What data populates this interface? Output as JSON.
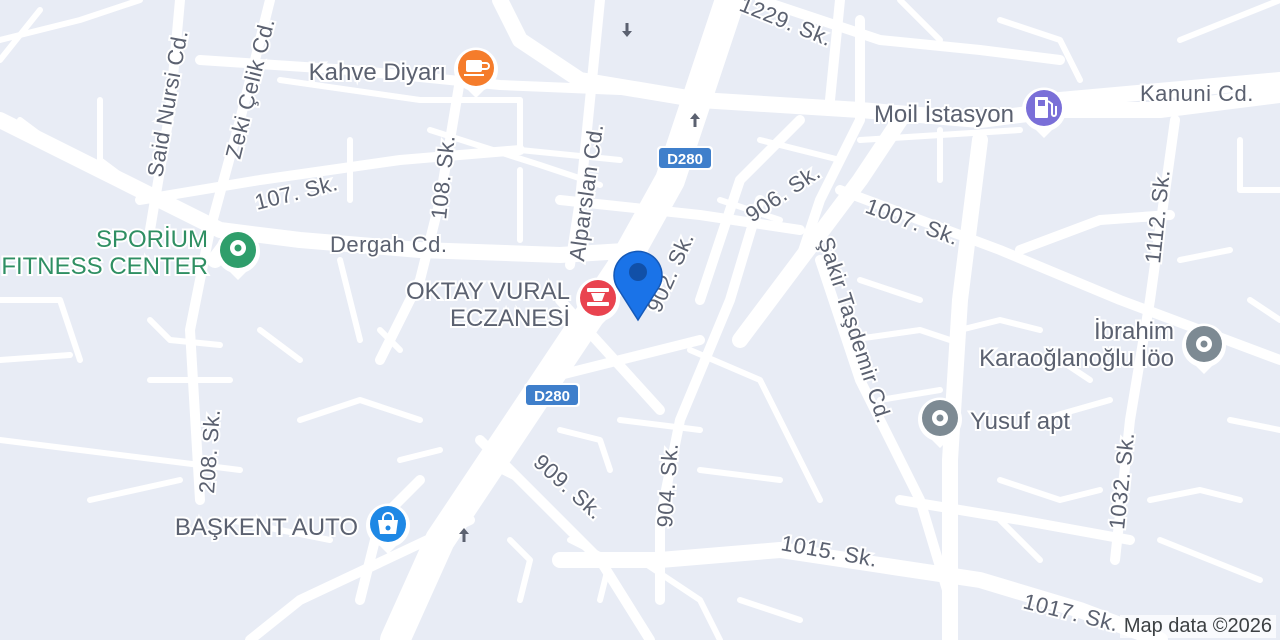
{
  "map": {
    "streets": {
      "said_nursi": "Said Nursi Cd.",
      "zeki_celik": "Zeki Çelik Cd.",
      "s1229": "1229. Sk.",
      "kanuni": "Kanuni Cd.",
      "alparslan": "Alparslan Cd.",
      "s108": "108. Sk.",
      "s107": "107. Sk.",
      "s906": "906. Sk.",
      "s1007": "1007. Sk.",
      "s1112": "1112. Sk.",
      "dergah": "Dergah Cd.",
      "s902": "902. Sk.",
      "sakir": "Şakir Taşdemir Cd.",
      "s208": "208. Sk.",
      "s909": "909. Sk.",
      "s904": "904. Sk.",
      "s1015": "1015. Sk.",
      "s1032": "1032. Sk.",
      "s1017": "1017. Sk."
    },
    "road_shields": [
      "D280",
      "D280"
    ],
    "pois": {
      "kahve": {
        "name": "Kahve Diyarı",
        "icon": "coffee-cup-icon",
        "color": "#f57c2b"
      },
      "moil": {
        "name": "Moil İstasyon",
        "icon": "fuel-pump-icon",
        "color": "#7a6fd8"
      },
      "sporium_line1": "SPORİUM",
      "sporium_line2": "FITNESS CENTER",
      "sporium": {
        "icon": "fitness-pin-icon",
        "color": "#2f9e6b"
      },
      "oktay_line1": "OKTAY VURAL",
      "oktay_line2": "ECZANESİ",
      "oktay": {
        "icon": "pharmacy-mortar-icon",
        "color": "#e9434f"
      },
      "ibrahim_line1": "İbrahim",
      "ibrahim_line2": "Karaoğlanoğlu İöo",
      "ibrahim": {
        "icon": "generic-pin-icon",
        "color": "#7d8a93"
      },
      "yusuf": {
        "name": "Yusuf apt",
        "icon": "generic-pin-icon",
        "color": "#7d8a93"
      },
      "baskent": {
        "name": "BAŞKENT AUTO",
        "icon": "shopping-bag-icon",
        "color": "#1e88e5"
      }
    },
    "location_marker": {
      "icon": "location-pin-icon",
      "color": "#1a73e8"
    },
    "attribution": "Map data ©2026"
  }
}
